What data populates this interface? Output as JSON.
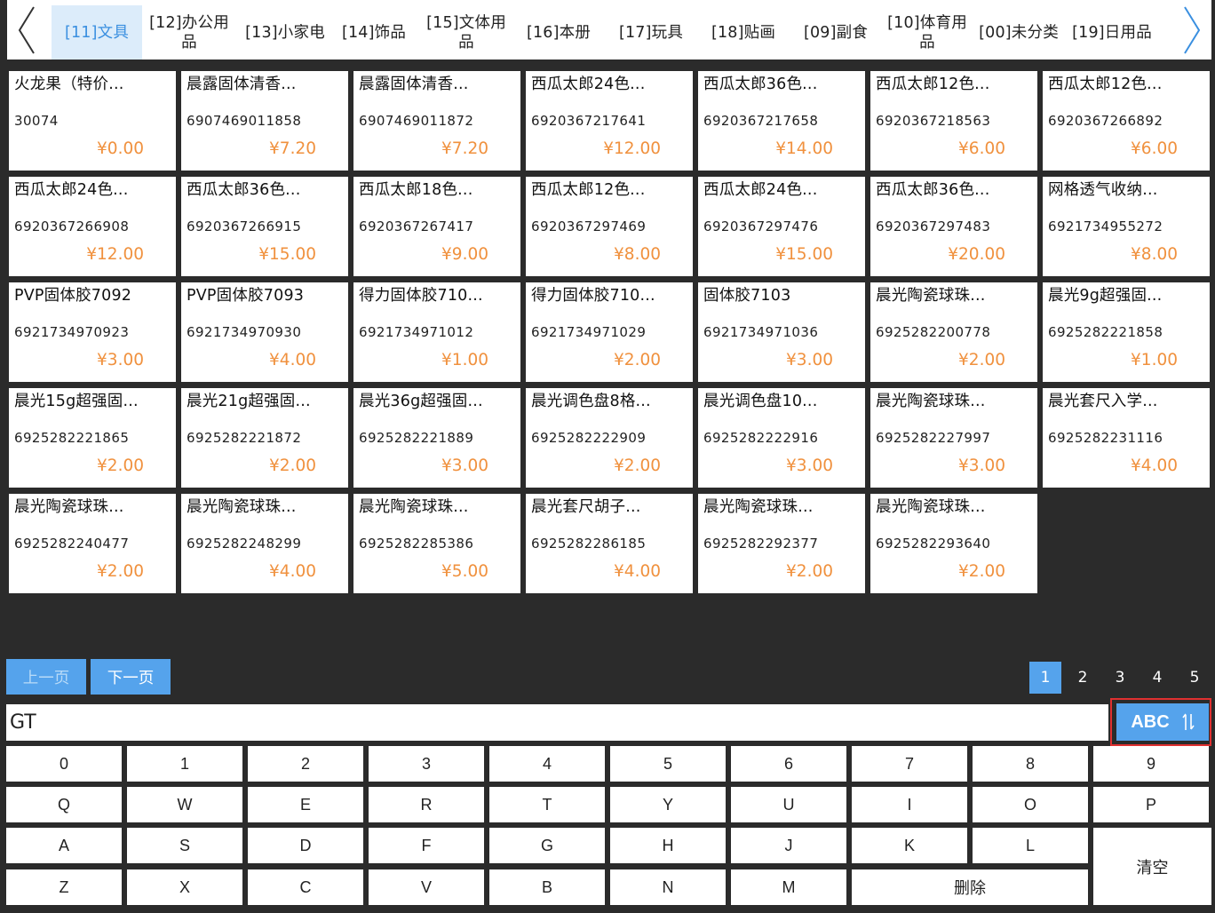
{
  "categories": [
    {
      "label": "[11]文具",
      "active": true
    },
    {
      "label": "[12]办公用品"
    },
    {
      "label": "[13]小家电"
    },
    {
      "label": "[14]饰品"
    },
    {
      "label": "[15]文体用品"
    },
    {
      "label": "[16]本册"
    },
    {
      "label": "[17]玩具"
    },
    {
      "label": "[18]贴画"
    },
    {
      "label": "[09]副食"
    },
    {
      "label": "[10]体育用品"
    },
    {
      "label": "[00]未分类"
    },
    {
      "label": "[19]日用品"
    }
  ],
  "products": [
    {
      "name": "火龙果（特价...",
      "code": "30074",
      "price": "¥0.00"
    },
    {
      "name": "晨露固体清香...",
      "code": "6907469011858",
      "price": "¥7.20"
    },
    {
      "name": "晨露固体清香...",
      "code": "6907469011872",
      "price": "¥7.20"
    },
    {
      "name": "西瓜太郎24色...",
      "code": "6920367217641",
      "price": "¥12.00"
    },
    {
      "name": "西瓜太郎36色...",
      "code": "6920367217658",
      "price": "¥14.00"
    },
    {
      "name": "西瓜太郎12色...",
      "code": "6920367218563",
      "price": "¥6.00"
    },
    {
      "name": "西瓜太郎12色...",
      "code": "6920367266892",
      "price": "¥6.00"
    },
    {
      "name": "西瓜太郎24色...",
      "code": "6920367266908",
      "price": "¥12.00"
    },
    {
      "name": "西瓜太郎36色...",
      "code": "6920367266915",
      "price": "¥15.00"
    },
    {
      "name": "西瓜太郎18色...",
      "code": "6920367267417",
      "price": "¥9.00"
    },
    {
      "name": "西瓜太郎12色...",
      "code": "6920367297469",
      "price": "¥8.00"
    },
    {
      "name": "西瓜太郎24色...",
      "code": "6920367297476",
      "price": "¥15.00"
    },
    {
      "name": "西瓜太郎36色...",
      "code": "6920367297483",
      "price": "¥20.00"
    },
    {
      "name": "网格透气收纳...",
      "code": "6921734955272",
      "price": "¥8.00"
    },
    {
      "name": "PVP固体胶7092",
      "code": "6921734970923",
      "price": "¥3.00"
    },
    {
      "name": "PVP固体胶7093",
      "code": "6921734970930",
      "price": "¥4.00"
    },
    {
      "name": "得力固体胶710...",
      "code": "6921734971012",
      "price": "¥1.00"
    },
    {
      "name": "得力固体胶710...",
      "code": "6921734971029",
      "price": "¥2.00"
    },
    {
      "name": "固体胶7103",
      "code": "6921734971036",
      "price": "¥3.00"
    },
    {
      "name": "晨光陶瓷球珠...",
      "code": "6925282200778",
      "price": "¥2.00"
    },
    {
      "name": "晨光9g超强固...",
      "code": "6925282221858",
      "price": "¥1.00"
    },
    {
      "name": "晨光15g超强固...",
      "code": "6925282221865",
      "price": "¥2.00"
    },
    {
      "name": "晨光21g超强固...",
      "code": "6925282221872",
      "price": "¥2.00"
    },
    {
      "name": "晨光36g超强固...",
      "code": "6925282221889",
      "price": "¥3.00"
    },
    {
      "name": "晨光调色盘8格...",
      "code": "6925282222909",
      "price": "¥2.00"
    },
    {
      "name": "晨光调色盘10...",
      "code": "6925282222916",
      "price": "¥3.00"
    },
    {
      "name": "晨光陶瓷球珠...",
      "code": "6925282227997",
      "price": "¥3.00"
    },
    {
      "name": "晨光套尺入学...",
      "code": "6925282231116",
      "price": "¥4.00"
    },
    {
      "name": "晨光陶瓷球珠...",
      "code": "6925282240477",
      "price": "¥2.00"
    },
    {
      "name": "晨光陶瓷球珠...",
      "code": "6925282248299",
      "price": "¥4.00"
    },
    {
      "name": "晨光陶瓷球珠...",
      "code": "6925282285386",
      "price": "¥5.00"
    },
    {
      "name": "晨光套尺胡子...",
      "code": "6925282286185",
      "price": "¥4.00"
    },
    {
      "name": "晨光陶瓷球珠...",
      "code": "6925282292377",
      "price": "¥2.00"
    },
    {
      "name": "晨光陶瓷球珠...",
      "code": "6925282293640",
      "price": "¥2.00"
    }
  ],
  "paging": {
    "prev_label": "上一页",
    "next_label": "下一页",
    "pages": [
      "1",
      "2",
      "3",
      "4",
      "5"
    ],
    "current": "1"
  },
  "search": {
    "value": "GT",
    "mode_label": "ABC"
  },
  "keyboard": {
    "row1": [
      "0",
      "1",
      "2",
      "3",
      "4",
      "5",
      "6",
      "7",
      "8",
      "9"
    ],
    "row2": [
      "Q",
      "W",
      "E",
      "R",
      "T",
      "Y",
      "U",
      "I",
      "O",
      "P"
    ],
    "row3": [
      "A",
      "S",
      "D",
      "F",
      "G",
      "H",
      "J",
      "K",
      "L"
    ],
    "row4": [
      "Z",
      "X",
      "C",
      "V",
      "B",
      "N",
      "M"
    ],
    "delete_label": "删除",
    "clear_label": "清空"
  },
  "colors": {
    "accent": "#55a3ec",
    "price": "#f0913e",
    "background": "#2b2b2b",
    "highlight_outline": "#e03030"
  },
  "icons": {
    "prev": "chevron-left-icon",
    "next": "chevron-right-icon",
    "mode_toggle": "swap-vertical-icon"
  }
}
